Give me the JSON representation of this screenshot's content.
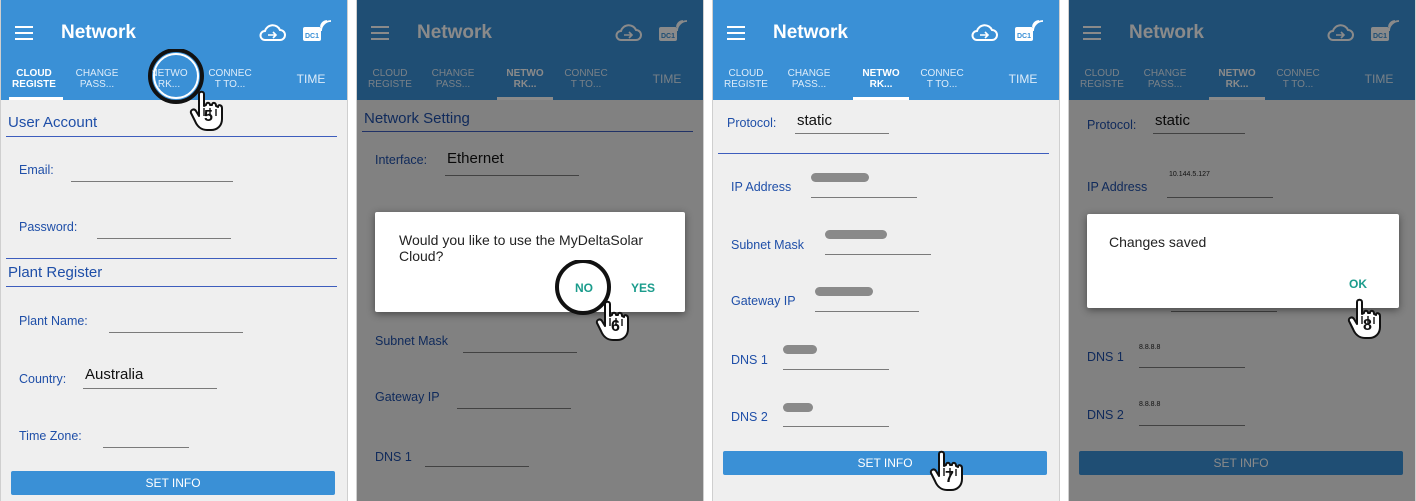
{
  "app": {
    "title": "Network"
  },
  "tabs": [
    {
      "label": "CLOUD\nREGISTE"
    },
    {
      "label": "CHANGE\nPASS..."
    },
    {
      "label": "NETWO\nRK..."
    },
    {
      "label": "CONNEC\nT TO..."
    },
    {
      "label": "TIME"
    }
  ],
  "icons": {
    "menu": "hamburger-icon",
    "cloud": "cloud-icon",
    "device": "dc1-wifi-icon",
    "tap": "hand-pointer-icon"
  },
  "colors": {
    "appbar": "#3a90d6",
    "accent": "#1f4fa8",
    "dialog_button": "#1b9c8c"
  },
  "screen1": {
    "user_account_heading": "User Account",
    "email_label": "Email:",
    "password_label": "Password:",
    "plant_register_heading": "Plant Register",
    "plant_name_label": "Plant Name:",
    "country_label": "Country:",
    "country_value": "Australia",
    "time_zone_label": "Time Zone:",
    "set_info_label": "SET INFO",
    "step": "5"
  },
  "screen2": {
    "heading": "Network Setting",
    "interface_label": "Interface:",
    "interface_value": "Ethernet",
    "subnet_mask_label": "Subnet Mask",
    "gateway_ip_label": "Gateway IP",
    "dns1_label": "DNS 1",
    "dialog_message": "Would you like to use the MyDeltaSolar Cloud?",
    "no_label": "NO",
    "yes_label": "YES",
    "step": "6"
  },
  "screen3": {
    "protocol_label": "Protocol:",
    "protocol_value": "static",
    "ip_address_label": "IP Address",
    "subnet_mask_label": "Subnet Mask",
    "gateway_ip_label": "Gateway IP",
    "dns1_label": "DNS 1",
    "dns2_label": "DNS 2",
    "set_info_label": "SET INFO",
    "step": "7"
  },
  "screen4": {
    "protocol_label": "Protocol:",
    "protocol_value": "static",
    "ip_address_label": "IP Address",
    "ip_address_value": "10.144.5.127",
    "dns1_label": "DNS 1",
    "dns1_value": "8.8.8.8",
    "dns2_label": "DNS 2",
    "dns2_value": "8.8.8.8",
    "set_info_label": "SET INFO",
    "dialog_message": "Changes saved",
    "ok_label": "OK",
    "step": "8"
  }
}
